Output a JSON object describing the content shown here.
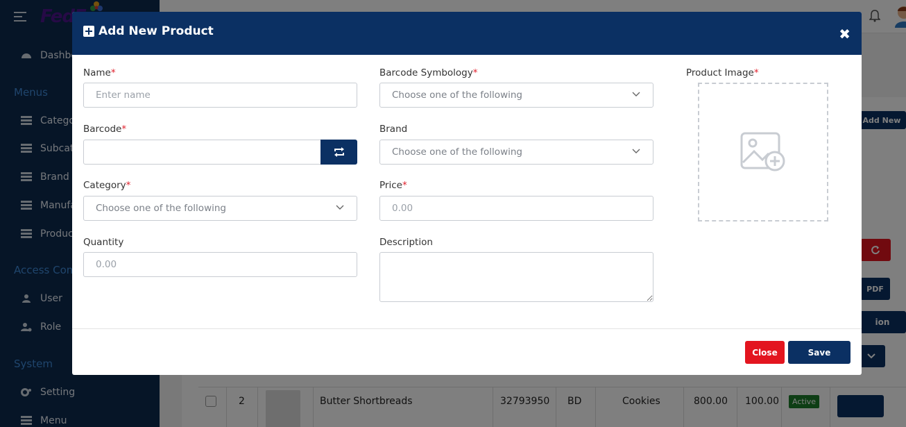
{
  "background": {
    "brand": "FedEx",
    "nav_sections": {
      "menus": "Menus",
      "access": "Access Con",
      "system": "System"
    },
    "nav_items": {
      "dashboard": "Dashbo",
      "category": "Categor",
      "subcategory": "Subcate",
      "brand": "Brand",
      "manufacturer": "Manufa",
      "product": "Product",
      "user": "User",
      "role": "Role",
      "setting": "Setting",
      "menu": "Menu"
    },
    "buttons": {
      "add_new": "Add New",
      "pdf": "PDF",
      "action": "ion"
    },
    "table_row": {
      "index": "2",
      "name": "Butter Shortbreads",
      "barcode": "32793950",
      "code": "BD",
      "category": "Cookies",
      "price": "800.00",
      "quantity": "100.00",
      "status": "Active"
    }
  },
  "modal": {
    "title": "Add New Product",
    "fields": {
      "name": {
        "label": "Name",
        "placeholder": "Enter name",
        "value": ""
      },
      "barcode_symbology": {
        "label": "Barcode Symbology",
        "value": "Choose one of the following"
      },
      "product_image": {
        "label": "Product Image"
      },
      "barcode": {
        "label": "Barcode",
        "value": ""
      },
      "brand": {
        "label": "Brand",
        "value": "Choose one of the following"
      },
      "category": {
        "label": "Category",
        "value": "Choose one of the following"
      },
      "price": {
        "label": "Price",
        "placeholder": "0.00",
        "value": ""
      },
      "quantity": {
        "label": "Quantity",
        "placeholder": "0.00",
        "value": ""
      },
      "description": {
        "label": "Description",
        "value": ""
      }
    },
    "required_marker": "*",
    "footer": {
      "close_label": "Close",
      "save_label": "Save"
    }
  },
  "colors": {
    "primary": "#0b3063",
    "danger": "#e3151f",
    "required": "#e0202c",
    "sidebar": "#0d2a4f"
  }
}
